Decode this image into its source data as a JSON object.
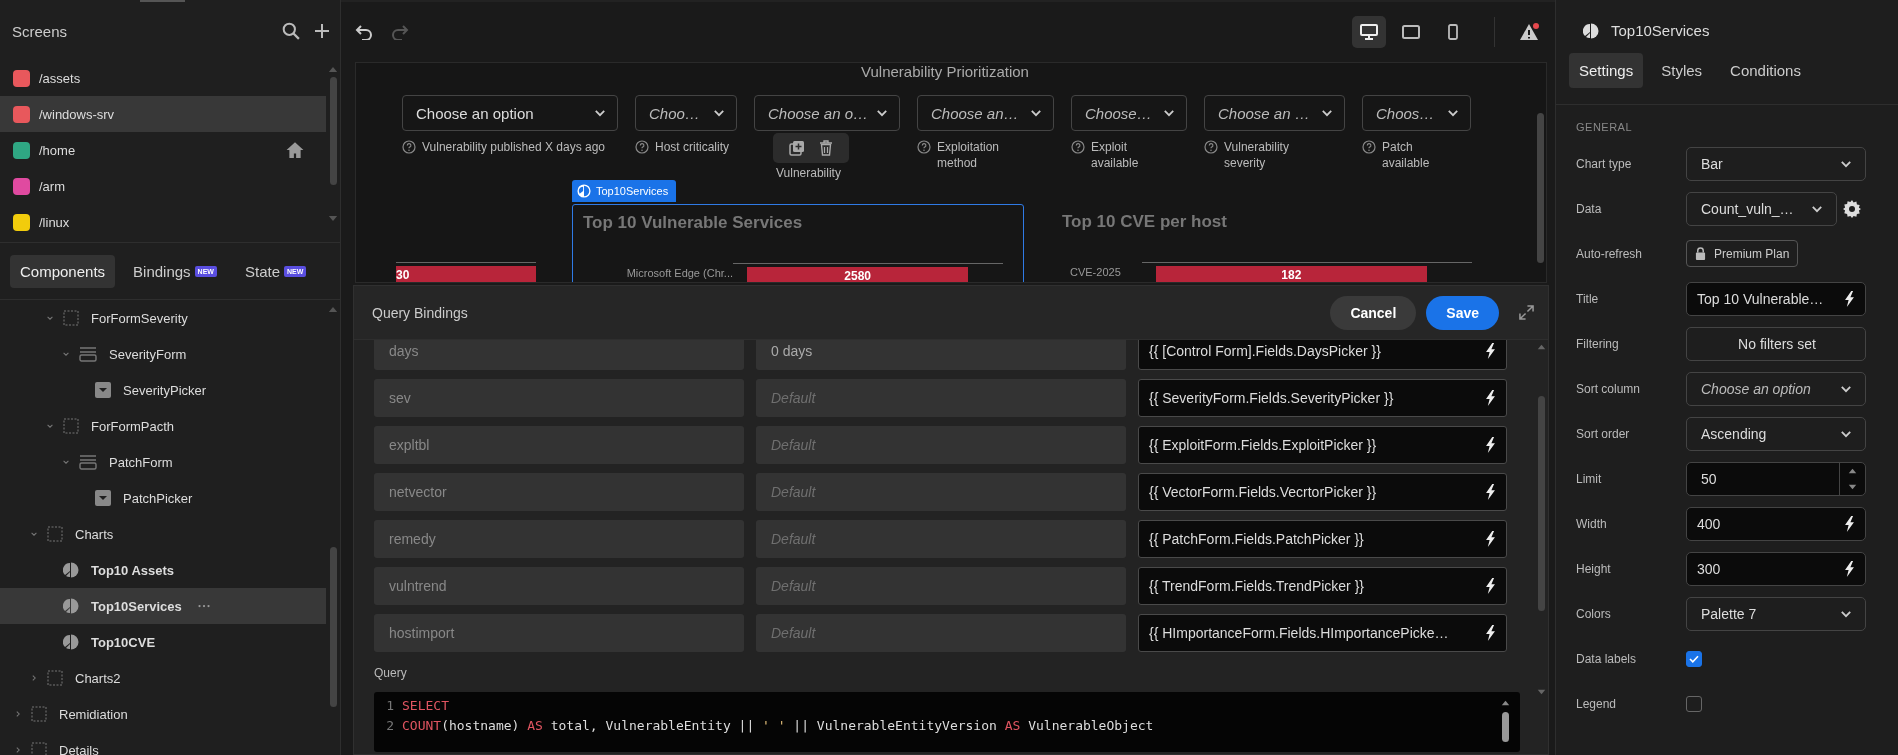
{
  "screens_panel": {
    "title": "Screens",
    "items": [
      {
        "label": "/assets",
        "color": "#e8585c",
        "selected": false,
        "home": false
      },
      {
        "label": "/windows-srv",
        "color": "#e8585c",
        "selected": true,
        "home": false
      },
      {
        "label": "/home",
        "color": "#2fa783",
        "selected": false,
        "home": true
      },
      {
        "label": "/arm",
        "color": "#e04aa0",
        "selected": false,
        "home": false
      },
      {
        "label": "/linux",
        "color": "#f2cc0c",
        "selected": false,
        "home": false
      }
    ]
  },
  "panel_tabs": [
    {
      "label": "Components",
      "selected": true
    },
    {
      "label": "Bindings",
      "badge": "NEW",
      "selected": false
    },
    {
      "label": "State",
      "badge": "NEW",
      "selected": false
    }
  ],
  "component_tree": [
    {
      "children": [
        {
          "children": [
            {
              "label": "ForFormSeverity",
              "kind": "container",
              "expanded": true,
              "selected": false,
              "children": [
                {
                  "label": "SeverityForm",
                  "kind": "form",
                  "expanded": true,
                  "selected": false,
                  "children": [
                    {
                      "label": "SeverityPicker",
                      "kind": "picker",
                      "selected": false
                    }
                  ]
                }
              ]
            },
            {
              "label": "ForFormPacth",
              "kind": "container",
              "expanded": true,
              "selected": false,
              "children": [
                {
                  "label": "PatchForm",
                  "kind": "form",
                  "expanded": true,
                  "selected": false,
                  "children": [
                    {
                      "label": "PatchPicker",
                      "kind": "picker",
                      "selected": false
                    }
                  ]
                }
              ]
            }
          ]
        },
        {
          "label": "Charts",
          "kind": "container",
          "expanded": true,
          "selected": false,
          "children": [
            {
              "label": "Top10 Assets",
              "kind": "chart",
              "selected": false
            },
            {
              "label": "Top10Services",
              "kind": "chart",
              "selected": true
            },
            {
              "label": "Top10CVE",
              "kind": "chart",
              "selected": false
            }
          ]
        },
        {
          "label": "Charts2",
          "kind": "container",
          "expanded": false,
          "selected": false
        }
      ]
    },
    {
      "label": "Remidiation",
      "kind": "container",
      "expanded": false,
      "selected": false
    },
    {
      "label": "Details",
      "kind": "container",
      "expanded": false,
      "selected": false
    }
  ],
  "toolbar": {
    "redo_disabled": true,
    "devices": [
      {
        "kind": "desktop",
        "selected": true
      },
      {
        "kind": "tablet",
        "selected": false
      },
      {
        "kind": "mobile",
        "selected": false
      }
    ]
  },
  "canvas": {
    "page_title": "Vulnerability Prioritization",
    "filters": [
      {
        "value": "Choose an option",
        "label": "Vulnerability published X days ago"
      },
      {
        "placeholder": "Choo…",
        "label": "Host criticality"
      },
      {
        "placeholder": "Choose an o…",
        "label": "Vulnerability",
        "covered": true
      },
      {
        "placeholder": "Choose an…",
        "label": "Exploitation method"
      },
      {
        "placeholder": "Choose…",
        "label": "Exploit available"
      },
      {
        "placeholder": "Choose an …",
        "label": "Vulnerability severity"
      },
      {
        "placeholder": "Choos…",
        "label": "Patch available"
      }
    ],
    "selection_tag": "Top10Services",
    "charts": [
      {
        "bar_label": "30",
        "selected": false
      },
      {
        "title": "Top 10 Vulnerable Services",
        "category": "Microsoft Edge (Chr...",
        "bar_label": "2580",
        "selected": true
      },
      {
        "title": "Top 10 CVE per host",
        "category": "CVE-2025",
        "bar_label": "182",
        "selected": false
      }
    ]
  },
  "query_bindings": {
    "title": "Query Bindings",
    "cancel": "Cancel",
    "save": "Save",
    "rows": [
      {
        "name": "days",
        "value": "0 days",
        "binding": "{{ [Control Form].Fields.DaysPicker }}"
      },
      {
        "name": "sev",
        "placeholder": "Default",
        "binding": "{{ SeverityForm.Fields.SeverityPicker }}"
      },
      {
        "name": "expltbl",
        "placeholder": "Default",
        "binding": "{{ ExploitForm.Fields.ExploitPicker }}"
      },
      {
        "name": "netvector",
        "placeholder": "Default",
        "binding": "{{ VectorForm.Fields.VecrtorPicker }}"
      },
      {
        "name": "remedy",
        "placeholder": "Default",
        "binding": "{{ PatchForm.Fields.PatchPicker }}"
      },
      {
        "name": "vulntrend",
        "placeholder": "Default",
        "binding": "{{ TrendForm.Fields.TrendPicker }}"
      },
      {
        "name": "hostimport",
        "placeholder": "Default",
        "binding": "{{ HImportanceForm.Fields.HImportancePicke…"
      }
    ],
    "query_label": "Query",
    "query_lines": [
      {
        "number": "1",
        "tokens": [
          {
            "kind": "keyword",
            "text": "SELECT"
          }
        ]
      },
      {
        "number": "2",
        "tokens": [
          {
            "kind": "keyword",
            "text": "COUNT"
          },
          {
            "kind": "plain",
            "text": "(hostname) "
          },
          {
            "kind": "keyword",
            "text": "AS"
          },
          {
            "kind": "plain",
            "text": " total, VulnerableEntity || "
          },
          {
            "kind": "string",
            "text": "' '"
          },
          {
            "kind": "plain",
            "text": " || VulnerableEntityVersion "
          },
          {
            "kind": "keyword",
            "text": "AS"
          },
          {
            "kind": "plain",
            "text": " VulnerableObject"
          }
        ]
      }
    ]
  },
  "properties": {
    "component": "Top10Services",
    "tabs": [
      {
        "label": "Settings",
        "selected": true
      },
      {
        "label": "Styles",
        "selected": false
      },
      {
        "label": "Conditions",
        "selected": false
      }
    ],
    "section": "GENERAL",
    "rows": [
      {
        "label": "Chart type",
        "kind": "select",
        "value": "Bar"
      },
      {
        "label": "Data",
        "kind": "select-gear",
        "value": "Count_vuln_…"
      },
      {
        "label": "Auto-refresh",
        "kind": "locked",
        "value": "Premium Plan"
      },
      {
        "label": "Title",
        "kind": "bound",
        "value": "Top 10 Vulnerable…"
      },
      {
        "label": "Filtering",
        "kind": "button",
        "value": "No filters set"
      },
      {
        "label": "Sort column",
        "kind": "select",
        "placeholder": "Choose an option"
      },
      {
        "label": "Sort order",
        "kind": "select",
        "value": "Ascending"
      },
      {
        "label": "Limit",
        "kind": "number",
        "value": "50"
      },
      {
        "label": "Width",
        "kind": "bound",
        "value": "400"
      },
      {
        "label": "Height",
        "kind": "bound",
        "value": "300"
      },
      {
        "label": "Colors",
        "kind": "select",
        "value": "Palette 7"
      },
      {
        "label": "Data labels",
        "kind": "checkbox",
        "checked": true
      },
      {
        "label": "Legend",
        "kind": "checkbox",
        "checked": false
      }
    ]
  }
}
